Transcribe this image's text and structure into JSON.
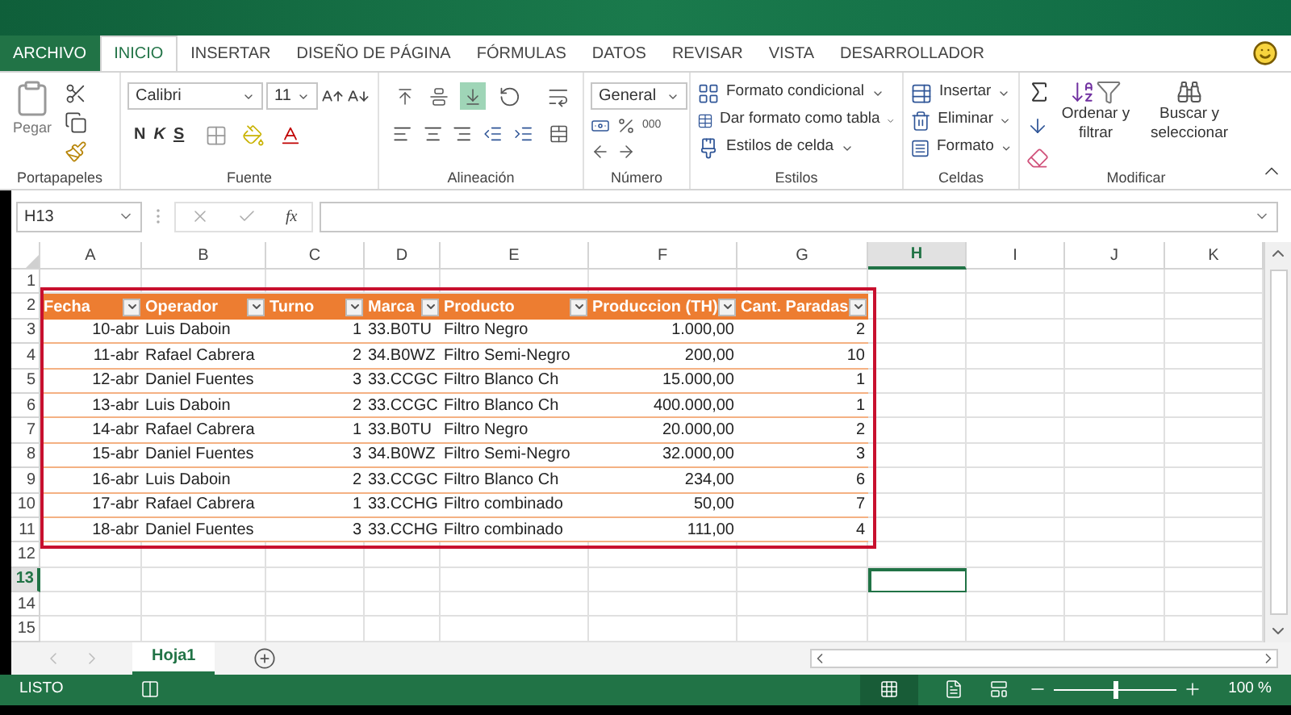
{
  "ribbon_tabs": [
    {
      "label": "ARCHIVO",
      "kind": "file",
      "selected": false
    },
    {
      "label": "INICIO",
      "kind": "tab",
      "selected": true
    },
    {
      "label": "INSERTAR",
      "kind": "tab",
      "selected": false
    },
    {
      "label": "DISEÑO DE PÁGINA",
      "kind": "tab",
      "selected": false
    },
    {
      "label": "FÓRMULAS",
      "kind": "tab",
      "selected": false
    },
    {
      "label": "DATOS",
      "kind": "tab",
      "selected": false
    },
    {
      "label": "REVISAR",
      "kind": "tab",
      "selected": false
    },
    {
      "label": "VISTA",
      "kind": "tab",
      "selected": false
    },
    {
      "label": "DESARROLLADOR",
      "kind": "tab",
      "selected": false
    }
  ],
  "ribbon": {
    "clipboard": {
      "label": "Portapapeles",
      "paste": "Pegar"
    },
    "font": {
      "label": "Fuente",
      "family": "Calibri",
      "size": "11",
      "styles": [
        "N",
        "K",
        "S"
      ]
    },
    "alignment": {
      "label": "Alineación",
      "vertical_align": [
        {
          "selected": false
        },
        {
          "selected": false
        },
        {
          "selected": true
        }
      ]
    },
    "number": {
      "label": "Número",
      "format": "General",
      "thousands": "000"
    },
    "styles": {
      "label": "Estilos",
      "buttons": [
        "Formato condicional",
        "Dar formato como tabla",
        "Estilos de celda"
      ]
    },
    "cells": {
      "label": "Celdas",
      "buttons": [
        "Insertar",
        "Eliminar",
        "Formato"
      ]
    },
    "editing": {
      "label": "Modificar",
      "sort": "Ordenar y filtrar",
      "find": "Buscar y seleccionar"
    }
  },
  "formula_bar": {
    "name_box": "H13",
    "function_label": "fx"
  },
  "columns": [
    {
      "label": "A",
      "selected": false
    },
    {
      "label": "B",
      "selected": false
    },
    {
      "label": "C",
      "selected": false
    },
    {
      "label": "D",
      "selected": false
    },
    {
      "label": "E",
      "selected": false
    },
    {
      "label": "F",
      "selected": false
    },
    {
      "label": "G",
      "selected": false
    },
    {
      "label": "H",
      "selected": true
    },
    {
      "label": "I",
      "selected": false
    },
    {
      "label": "J",
      "selected": false
    },
    {
      "label": "K",
      "selected": false
    }
  ],
  "rows": [
    {
      "label": "1",
      "selected": false
    },
    {
      "label": "2",
      "selected": false
    },
    {
      "label": "3",
      "selected": false
    },
    {
      "label": "4",
      "selected": false
    },
    {
      "label": "5",
      "selected": false
    },
    {
      "label": "6",
      "selected": false
    },
    {
      "label": "7",
      "selected": false
    },
    {
      "label": "8",
      "selected": false
    },
    {
      "label": "9",
      "selected": false
    },
    {
      "label": "10",
      "selected": false
    },
    {
      "label": "11",
      "selected": false
    },
    {
      "label": "12",
      "selected": false
    },
    {
      "label": "13",
      "selected": true
    },
    {
      "label": "14",
      "selected": false
    },
    {
      "label": "15",
      "selected": false
    }
  ],
  "table": {
    "columns": [
      {
        "label": "Fecha",
        "kind": "numeric"
      },
      {
        "label": "Operador",
        "kind": "text"
      },
      {
        "label": "Turno",
        "kind": "numeric"
      },
      {
        "label": "Marca",
        "kind": "text"
      },
      {
        "label": "Producto",
        "kind": "text"
      },
      {
        "label": "Produccion (TH)",
        "kind": "numeric"
      },
      {
        "label": "Cant. Paradas",
        "kind": "numeric"
      }
    ],
    "rows": [
      [
        "10-abr",
        "Luis Daboin",
        "1",
        "33.B0TU",
        "Filtro Negro",
        "1.000,00",
        "2"
      ],
      [
        "11-abr",
        "Rafael Cabrera",
        "2",
        "34.B0WZ",
        "Filtro Semi-Negro",
        "200,00",
        "10"
      ],
      [
        "12-abr",
        "Daniel Fuentes",
        "3",
        "33.CCGC",
        "Filtro Blanco Ch",
        "15.000,00",
        "1"
      ],
      [
        "13-abr",
        "Luis Daboin",
        "2",
        "33.CCGC",
        "Filtro Blanco Ch",
        "400.000,00",
        "1"
      ],
      [
        "14-abr",
        "Rafael Cabrera",
        "1",
        "33.B0TU",
        "Filtro Negro",
        "20.000,00",
        "2"
      ],
      [
        "15-abr",
        "Daniel Fuentes",
        "3",
        "34.B0WZ",
        "Filtro Semi-Negro",
        "32.000,00",
        "3"
      ],
      [
        "16-abr",
        "Luis Daboin",
        "2",
        "33.CCGC",
        "Filtro Blanco Ch",
        "234,00",
        "6"
      ],
      [
        "17-abr",
        "Rafael Cabrera",
        "1",
        "33.CCHG",
        "Filtro combinado",
        "50,00",
        "7"
      ],
      [
        "18-abr",
        "Daniel Fuentes",
        "3",
        "33.CCHG",
        "Filtro combinado",
        "111,00",
        "4"
      ]
    ]
  },
  "sheet_tabs": [
    {
      "label": "Hoja1",
      "selected": true
    }
  ],
  "status_bar": {
    "status": "LISTO",
    "zoom": "100 %",
    "zoom_slider": {
      "level": 0.5
    }
  }
}
